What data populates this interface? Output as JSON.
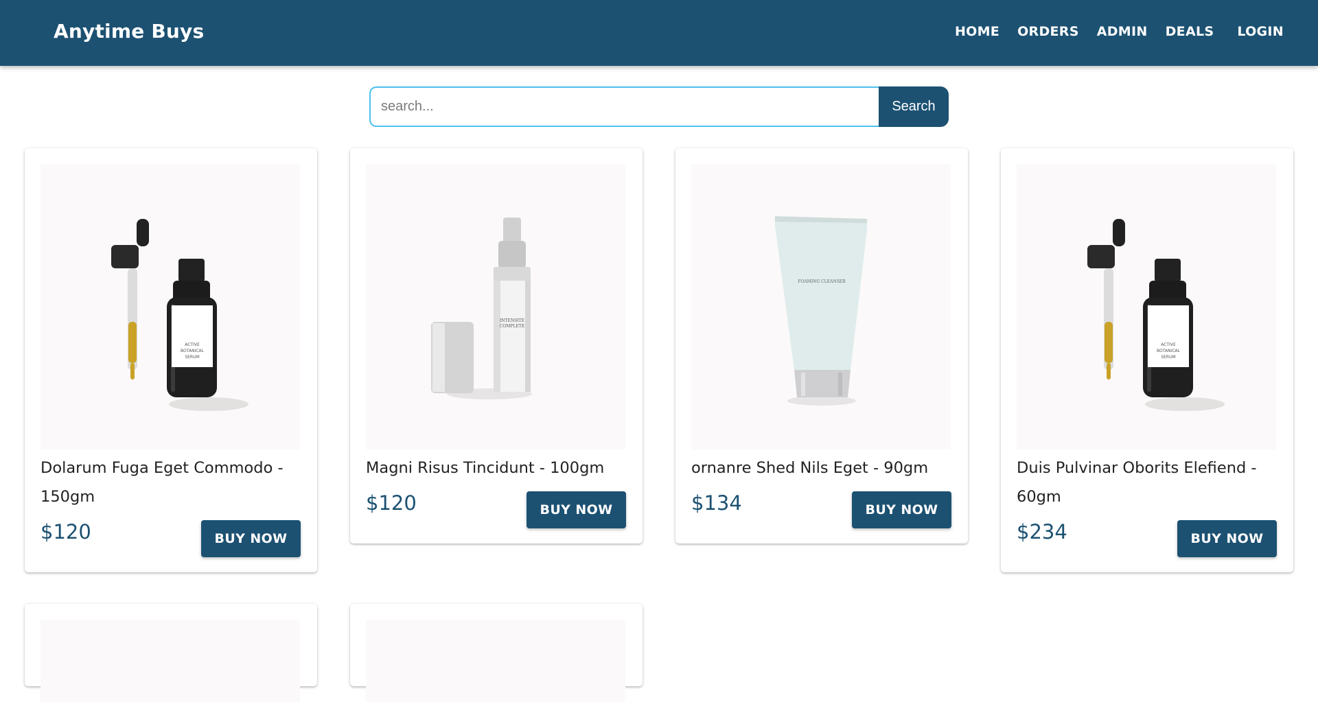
{
  "header": {
    "brand": "Anytime Buys",
    "nav": [
      {
        "label": "HOME"
      },
      {
        "label": "ORDERS"
      },
      {
        "label": "ADMIN"
      },
      {
        "label": "DEALS"
      },
      {
        "label": "LOGIN"
      }
    ],
    "color": "#1c5172"
  },
  "search": {
    "placeholder": "search...",
    "value": "",
    "button_label": "Search",
    "border_color": "#4cc0ec"
  },
  "products": [
    {
      "name": "Dolarum Fuga Eget Commodo - 150gm",
      "price": "$120",
      "button_label": "BUY NOW",
      "image_icon": "serum-dropper-bottle-icon"
    },
    {
      "name": "Magni Risus Tincidunt - 100gm",
      "price": "$120",
      "button_label": "BUY NOW",
      "image_icon": "pump-bottle-icon"
    },
    {
      "name": "ornanre Shed Nils Eget - 90gm",
      "price": "$134",
      "button_label": "BUY NOW",
      "image_icon": "cleanser-tube-icon"
    },
    {
      "name": "Duis Pulvinar Oborits Elefiend - 60gm",
      "price": "$234",
      "button_label": "BUY NOW",
      "image_icon": "serum-dropper-bottle-icon"
    }
  ],
  "product_labels": {
    "serum": [
      "ACTIVE",
      "BOTANICAL",
      "SERUM"
    ],
    "pump": [
      "INTENSITE",
      "COMPLETE"
    ],
    "tube": [
      "FOAMING CLEANSER"
    ]
  }
}
